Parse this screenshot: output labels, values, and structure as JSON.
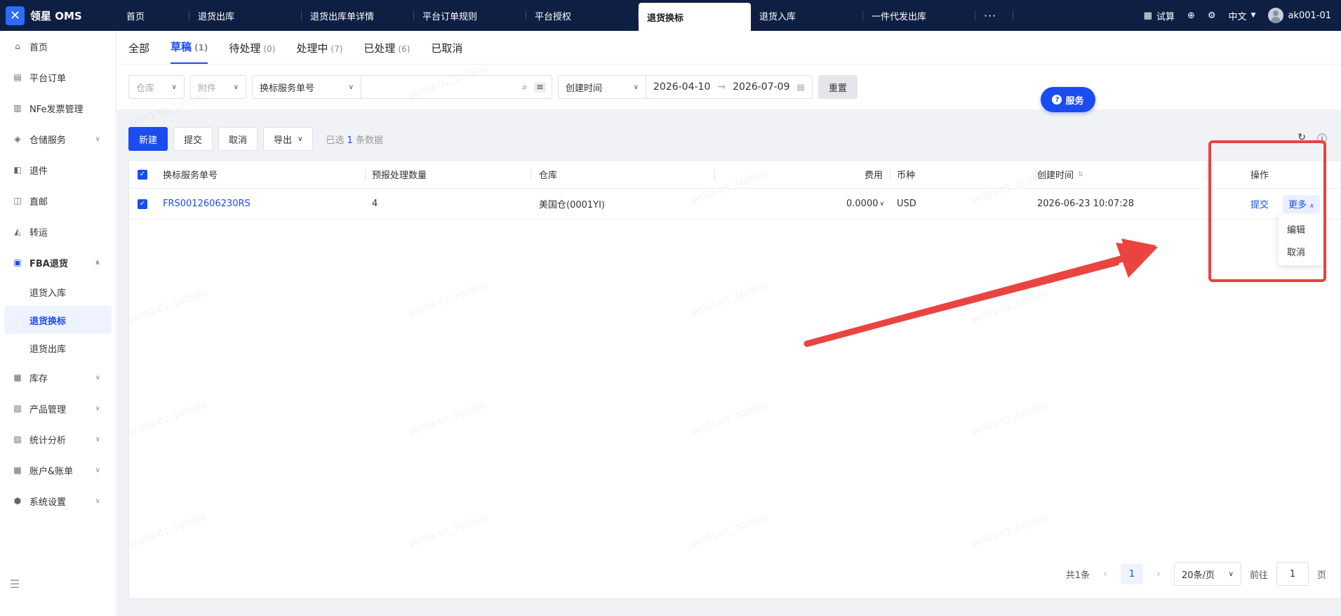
{
  "topbar": {
    "logo": "领星 OMS",
    "tabs": [
      "首页",
      "退货出库",
      "退货出库单详情",
      "平台订单规则",
      "平台授权",
      "退货换标",
      "退货入库",
      "一件代发出库",
      "···"
    ],
    "active_tab": "退货换标",
    "calc_label": "试算",
    "language": "中文",
    "user": "ak001-01"
  },
  "sidebar": {
    "items": [
      {
        "label": "首页",
        "icon": "home-icon"
      },
      {
        "label": "平台订单",
        "icon": "document-icon"
      },
      {
        "label": "NFe发票管理",
        "icon": "invoice-icon"
      },
      {
        "label": "仓储服务",
        "icon": "warehouse-icon"
      },
      {
        "label": "退件",
        "icon": "return-icon"
      },
      {
        "label": "直邮",
        "icon": "mail-icon"
      },
      {
        "label": "转运",
        "icon": "transfer-icon"
      },
      {
        "label": "FBA退货",
        "icon": "amazon-icon"
      }
    ],
    "fba_sub": [
      "退货入库",
      "退货换标",
      "退货出库"
    ],
    "items2": [
      {
        "label": "库存",
        "icon": "inventory-icon"
      },
      {
        "label": "产品管理",
        "icon": "product-icon"
      },
      {
        "label": "统计分析",
        "icon": "chart-icon"
      },
      {
        "label": "账户&账单",
        "icon": "account-icon"
      },
      {
        "label": "系统设置",
        "icon": "settings-icon"
      }
    ]
  },
  "status_tabs": [
    {
      "label": "全部",
      "count": ""
    },
    {
      "label": "草稿",
      "count": "(1)"
    },
    {
      "label": "待处理",
      "count": "(0)"
    },
    {
      "label": "处理中",
      "count": "(7)"
    },
    {
      "label": "已处理",
      "count": "(6)"
    },
    {
      "label": "已取消",
      "count": ""
    }
  ],
  "filters": {
    "warehouse_placeholder": "仓库",
    "attachment_placeholder": "附件",
    "search_field": "换标服务单号",
    "time_field": "创建时间",
    "date_start": "2026-04-10",
    "date_end": "2026-07-09",
    "reset": "重置"
  },
  "service_button": "服务",
  "toolbar": {
    "new": "新建",
    "submit": "提交",
    "cancel": "取消",
    "export": "导出",
    "selected_prefix": "已选",
    "selected_count": "1",
    "selected_suffix": "条数据"
  },
  "table": {
    "headers": {
      "order_no": "换标服务单号",
      "qty": "预报处理数量",
      "warehouse": "仓库",
      "fee": "费用",
      "currency": "币种",
      "created": "创建时间",
      "actions": "操作"
    },
    "rows": [
      {
        "order_no": "FRS0012606230RS",
        "qty": "4",
        "warehouse": "美国仓(0001YI)",
        "fee": "0.0000",
        "currency": "USD",
        "created": "2026-06-23 10:07:28",
        "action_submit": "提交",
        "action_more": "更多"
      }
    ]
  },
  "dropdown": [
    "编辑",
    "取消"
  ],
  "pager": {
    "total": "共1条",
    "page": "1",
    "size": "20条/页",
    "goto_prefix": "前往",
    "goto_value": "1",
    "goto_suffix": "页"
  },
  "watermark": "ak001-01_100500"
}
